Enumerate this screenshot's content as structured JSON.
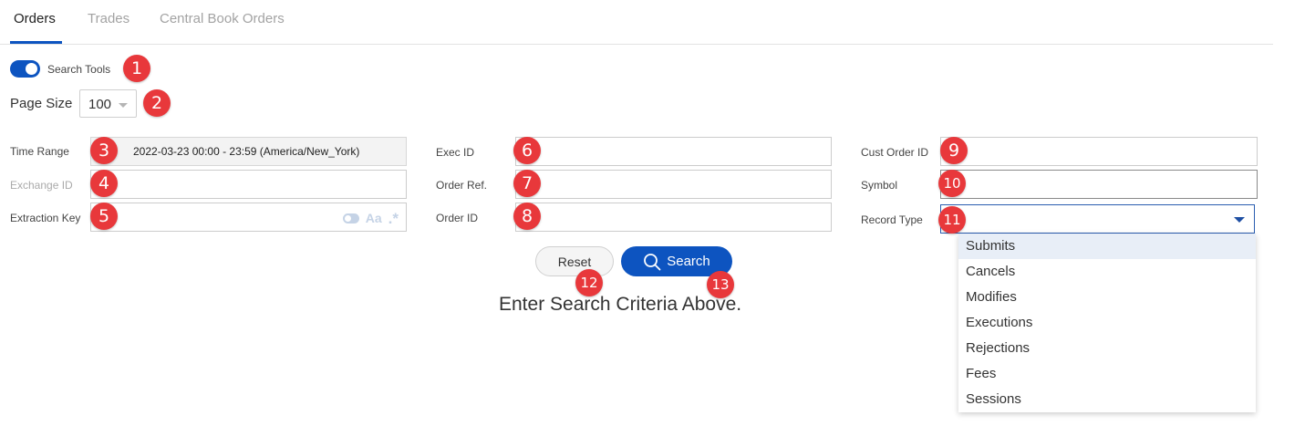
{
  "tabs": [
    {
      "label": "Orders",
      "active": true
    },
    {
      "label": "Trades",
      "active": false
    },
    {
      "label": "Central Book Orders",
      "active": false
    }
  ],
  "search_tools": {
    "label": "Search Tools",
    "enabled": true
  },
  "page_size": {
    "label": "Page Size",
    "value": "100"
  },
  "fields": {
    "time_range": {
      "label": "Time Range",
      "value": "2022-03-23 00:00 - 23:59 (America/New_York)"
    },
    "exchange_id": {
      "label": "Exchange ID",
      "value": ""
    },
    "extraction_key": {
      "label": "Extraction Key",
      "value": "",
      "icons": [
        "toggle-icon",
        "match-case-icon",
        "regex-icon"
      ],
      "aa_text": "Aa",
      "regex_text": ".*"
    },
    "exec_id": {
      "label": "Exec ID",
      "value": ""
    },
    "order_ref": {
      "label": "Order Ref.",
      "value": ""
    },
    "order_id": {
      "label": "Order ID",
      "value": ""
    },
    "cust_order_id": {
      "label": "Cust Order ID",
      "value": ""
    },
    "symbol": {
      "label": "Symbol",
      "value": ""
    },
    "record_type": {
      "label": "Record Type",
      "value": ""
    }
  },
  "record_type_options": [
    "Submits",
    "Cancels",
    "Modifies",
    "Executions",
    "Rejections",
    "Fees",
    "Sessions"
  ],
  "highlighted_option": "Submits",
  "buttons": {
    "reset": "Reset",
    "search": "Search"
  },
  "empty_message": "Enter Search Criteria Above.",
  "markers": [
    "1",
    "2",
    "3",
    "4",
    "5",
    "6",
    "7",
    "8",
    "9",
    "10",
    "11",
    "12",
    "13"
  ],
  "colors": {
    "primary": "#0d54c0",
    "marker": "#e8383b",
    "highlight": "#e8eef7"
  }
}
